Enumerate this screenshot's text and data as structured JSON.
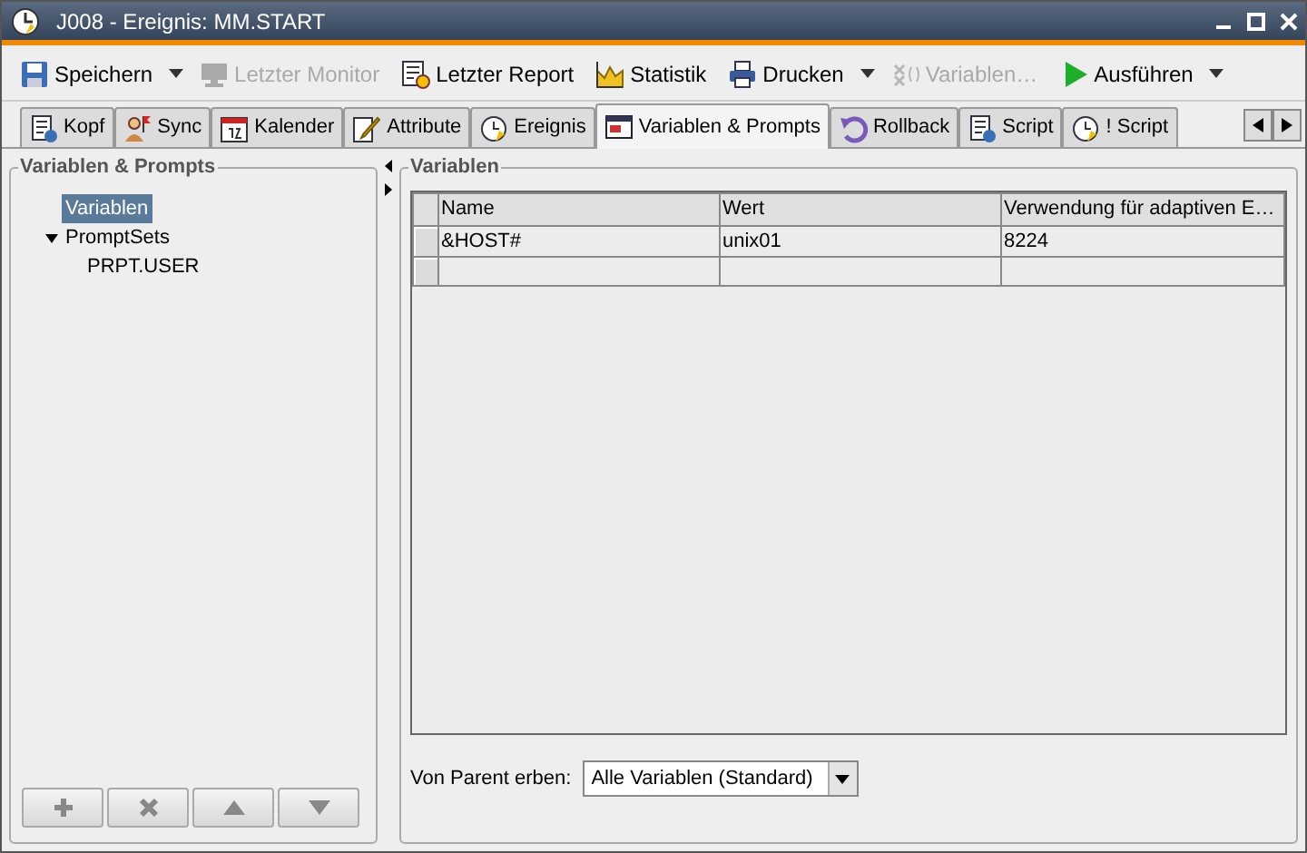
{
  "window": {
    "title": "J008 - Ereignis: MM.START"
  },
  "toolbar": [
    {
      "label": "Speichern",
      "disabled": false,
      "dropdown": true
    },
    {
      "label": "Letzter Monitor",
      "disabled": true,
      "dropdown": false
    },
    {
      "label": "Letzter Report",
      "disabled": false,
      "dropdown": false
    },
    {
      "label": "Statistik",
      "disabled": false,
      "dropdown": false
    },
    {
      "label": "Drucken",
      "disabled": false,
      "dropdown": true
    },
    {
      "label": "Variablen…",
      "disabled": true,
      "dropdown": false
    },
    {
      "label": "Ausführen",
      "disabled": false,
      "dropdown": true
    }
  ],
  "tabs": [
    {
      "label": "Kopf",
      "selected": false
    },
    {
      "label": "Sync",
      "selected": false
    },
    {
      "label": "Kalender",
      "selected": false
    },
    {
      "label": "Attribute",
      "selected": false
    },
    {
      "label": "Ereignis",
      "selected": false
    },
    {
      "label": "Variablen & Prompts",
      "selected": true
    },
    {
      "label": "Rollback",
      "selected": false
    },
    {
      "label": "Script",
      "selected": false
    },
    {
      "label": "! Script",
      "selected": false
    }
  ],
  "left_panel": {
    "title": "Variablen & Prompts",
    "tree": [
      {
        "label": "Variablen",
        "selected": true
      },
      {
        "label": "PromptSets",
        "selected": false,
        "expanded": true,
        "children": [
          {
            "label": "PRPT.USER",
            "selected": false
          }
        ]
      }
    ],
    "buttons": [
      {
        "kind": "add"
      },
      {
        "kind": "delete"
      },
      {
        "kind": "up"
      },
      {
        "kind": "down"
      }
    ]
  },
  "variables": {
    "title": "Variablen",
    "columns": [
      "Name",
      "Wert",
      "Verwendung für adaptiven E…"
    ],
    "rows": [
      [
        "&HOST#",
        "unix01",
        "8224"
      ],
      [
        "",
        "",
        ""
      ]
    ]
  },
  "inherit": {
    "label": "Von Parent erben:",
    "value": "Alle Variablen (Standard)"
  }
}
